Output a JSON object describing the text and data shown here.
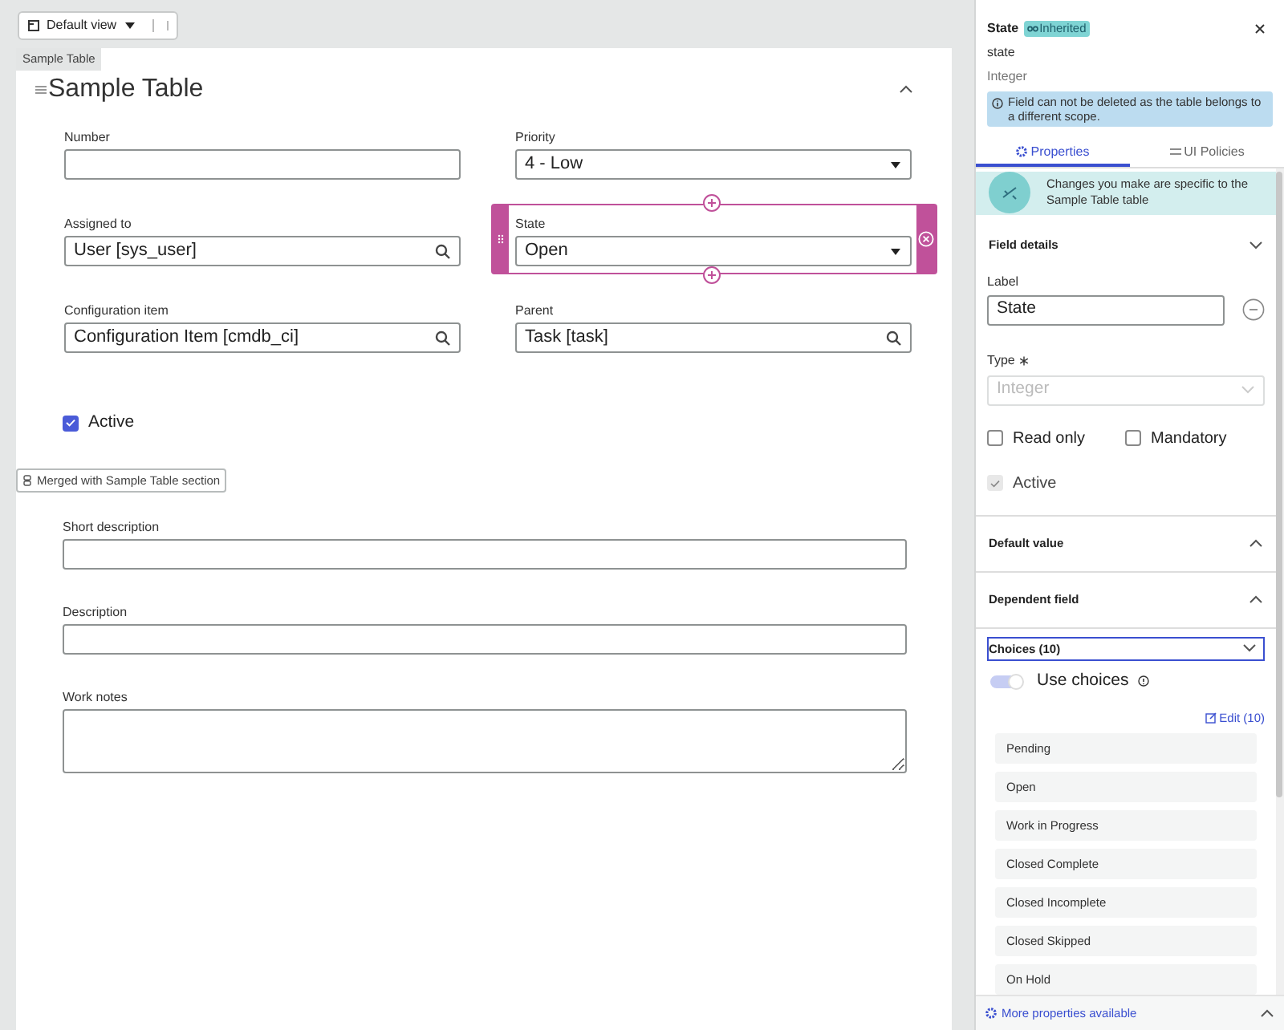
{
  "toolbar": {
    "view_label": "Default view"
  },
  "form": {
    "tab_label": "Sample Table",
    "title": "Sample Table",
    "fields": [
      {
        "label": "Number",
        "kind": "text",
        "selected": false
      },
      {
        "label": "Priority",
        "kind": "select",
        "value": "4 - Low",
        "selected": false
      },
      {
        "label": "Assigned to",
        "kind": "reference",
        "value": "User [sys_user]",
        "selected": false
      },
      {
        "label": "State",
        "kind": "select",
        "value": "Open",
        "selected": true
      },
      {
        "label": "Configuration item",
        "kind": "reference",
        "value": "Configuration Item [cmdb_ci]",
        "selected": false
      },
      {
        "label": "Parent",
        "kind": "reference",
        "value": "Task [task]",
        "selected": false
      }
    ],
    "active": {
      "label": "Active",
      "checked": true
    },
    "merged_label": "Merged with Sample Table section",
    "wide_fields": [
      {
        "label": "Short description",
        "kind": "text"
      },
      {
        "label": "Description",
        "kind": "text"
      },
      {
        "label": "Work notes",
        "kind": "textarea"
      }
    ]
  },
  "panel": {
    "title": "State",
    "badge": "Inherited",
    "field_name": "state",
    "field_type": "Integer",
    "notice": "Field can not be deleted as the table belongs to a different scope.",
    "tabs": [
      {
        "label": "Properties",
        "selected": true
      },
      {
        "label": "UI Policies",
        "selected": false
      }
    ],
    "info": "Changes you make are specific to the Sample Table table",
    "field_details": {
      "title": "Field details",
      "expanded": true,
      "label_caption": "Label",
      "label_value": "State",
      "type_caption": "Type",
      "type_value": "Integer",
      "checkboxes": [
        {
          "label": "Read only",
          "checked": false,
          "disabled": false
        },
        {
          "label": "Mandatory",
          "checked": false,
          "disabled": false
        },
        {
          "label": "Active",
          "checked": true,
          "disabled": true
        }
      ]
    },
    "sections": [
      {
        "title": "Default value",
        "expanded": false
      },
      {
        "title": "Dependent field",
        "expanded": false
      }
    ],
    "choices": {
      "title": "Choices (10)",
      "expanded": true,
      "toggle_label": "Use choices",
      "toggle_on": true,
      "edit_link": "Edit (10)",
      "items": [
        "Pending",
        "Open",
        "Work in Progress",
        "Closed Complete",
        "Closed Incomplete",
        "Closed Skipped",
        "On Hold"
      ]
    },
    "footer": "More properties available"
  }
}
